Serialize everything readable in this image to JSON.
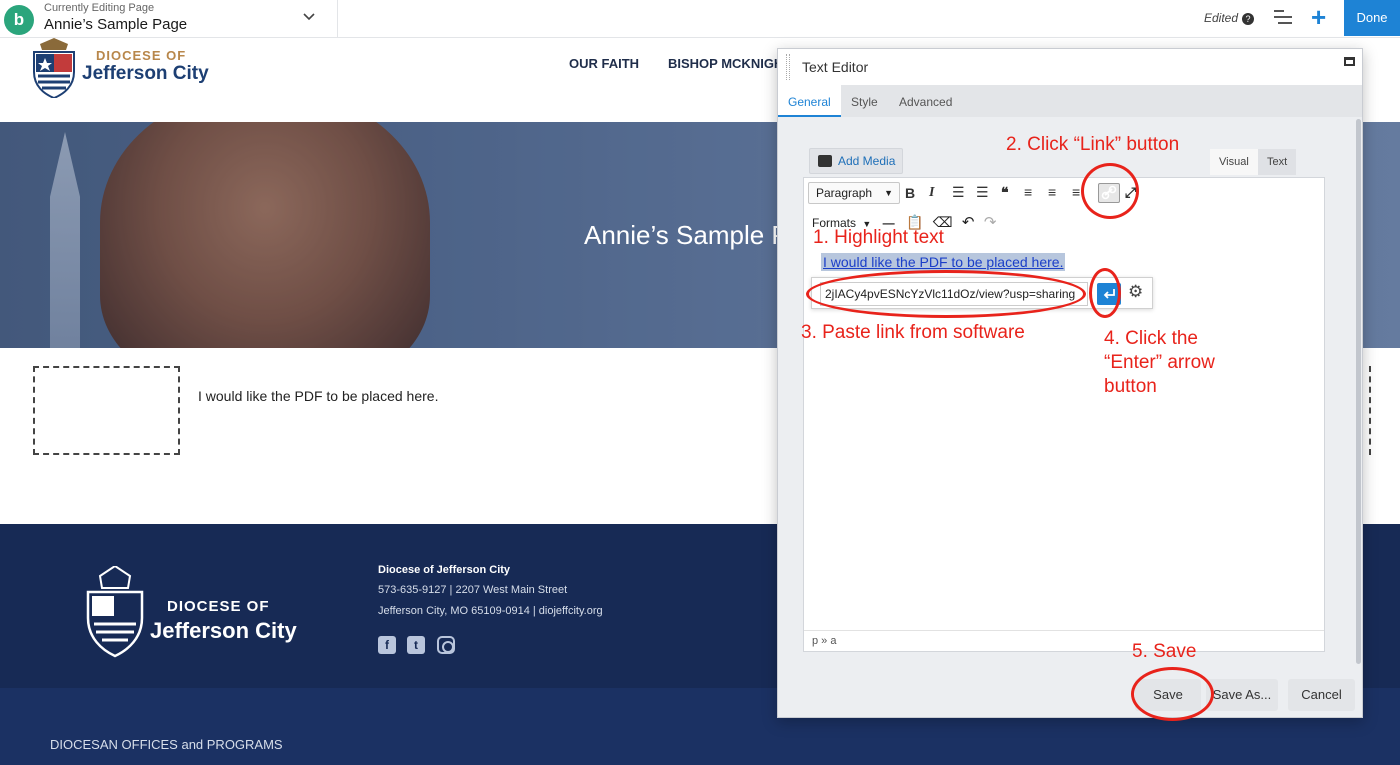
{
  "topbar": {
    "logo_letter": "b",
    "editing_label": "Currently Editing Page",
    "page_name": "Annie’s Sample Page",
    "chevron": "⌄",
    "edited_label": "Edited",
    "help_glyph": "?",
    "plus_glyph": "+",
    "done_label": "Done"
  },
  "site": {
    "org_top": "DIOCESE OF",
    "org_main": "Jefferson City",
    "nav": [
      "OUR FAITH",
      "BISHOP MCKNIGH"
    ],
    "hero_title": "Annie’s Sample P"
  },
  "content": {
    "paragraph": "I would like the PDF to be placed here."
  },
  "footer": {
    "org_top": "DIOCESE OF",
    "org_main": "Jefferson City",
    "name": "Diocese of Jefferson City",
    "line1": "573-635-9127 | 2207 West Main Street",
    "line2": "Jefferson City, MO 65109-0914 | diojeffcity.org",
    "social": [
      "f",
      "t",
      "instagram"
    ],
    "offices": "DIOCESAN OFFICES and PROGRAMS"
  },
  "panel": {
    "title": "Text Editor",
    "tabs": [
      "General",
      "Style",
      "Advanced"
    ],
    "active_tab": "General",
    "add_media": "Add Media",
    "view_tabs": [
      "Visual",
      "Text"
    ],
    "format_select": "Paragraph",
    "formats_label": "Formats",
    "selected_text": "I would like the PDF to be placed here.",
    "url_value": "2jIACy4pvESNcYzVlc11dOz/view?usp=sharing",
    "statusbar": "p » a",
    "buttons": {
      "save": "Save",
      "save_as": "Save As...",
      "cancel": "Cancel"
    }
  },
  "annotations": {
    "step1": "1. Highlight text",
    "step2": "2. Click “Link” button",
    "step3": "3. Paste link from software",
    "step4_line1": "4. Click the",
    "step4_line2": "“Enter” arrow",
    "step4_line3": "button",
    "step5": "5. Save"
  },
  "colors": {
    "accent": "#1e83d5",
    "annotation": "#e8231b",
    "footer": "#172a55",
    "brand_gold": "#b8874b"
  }
}
